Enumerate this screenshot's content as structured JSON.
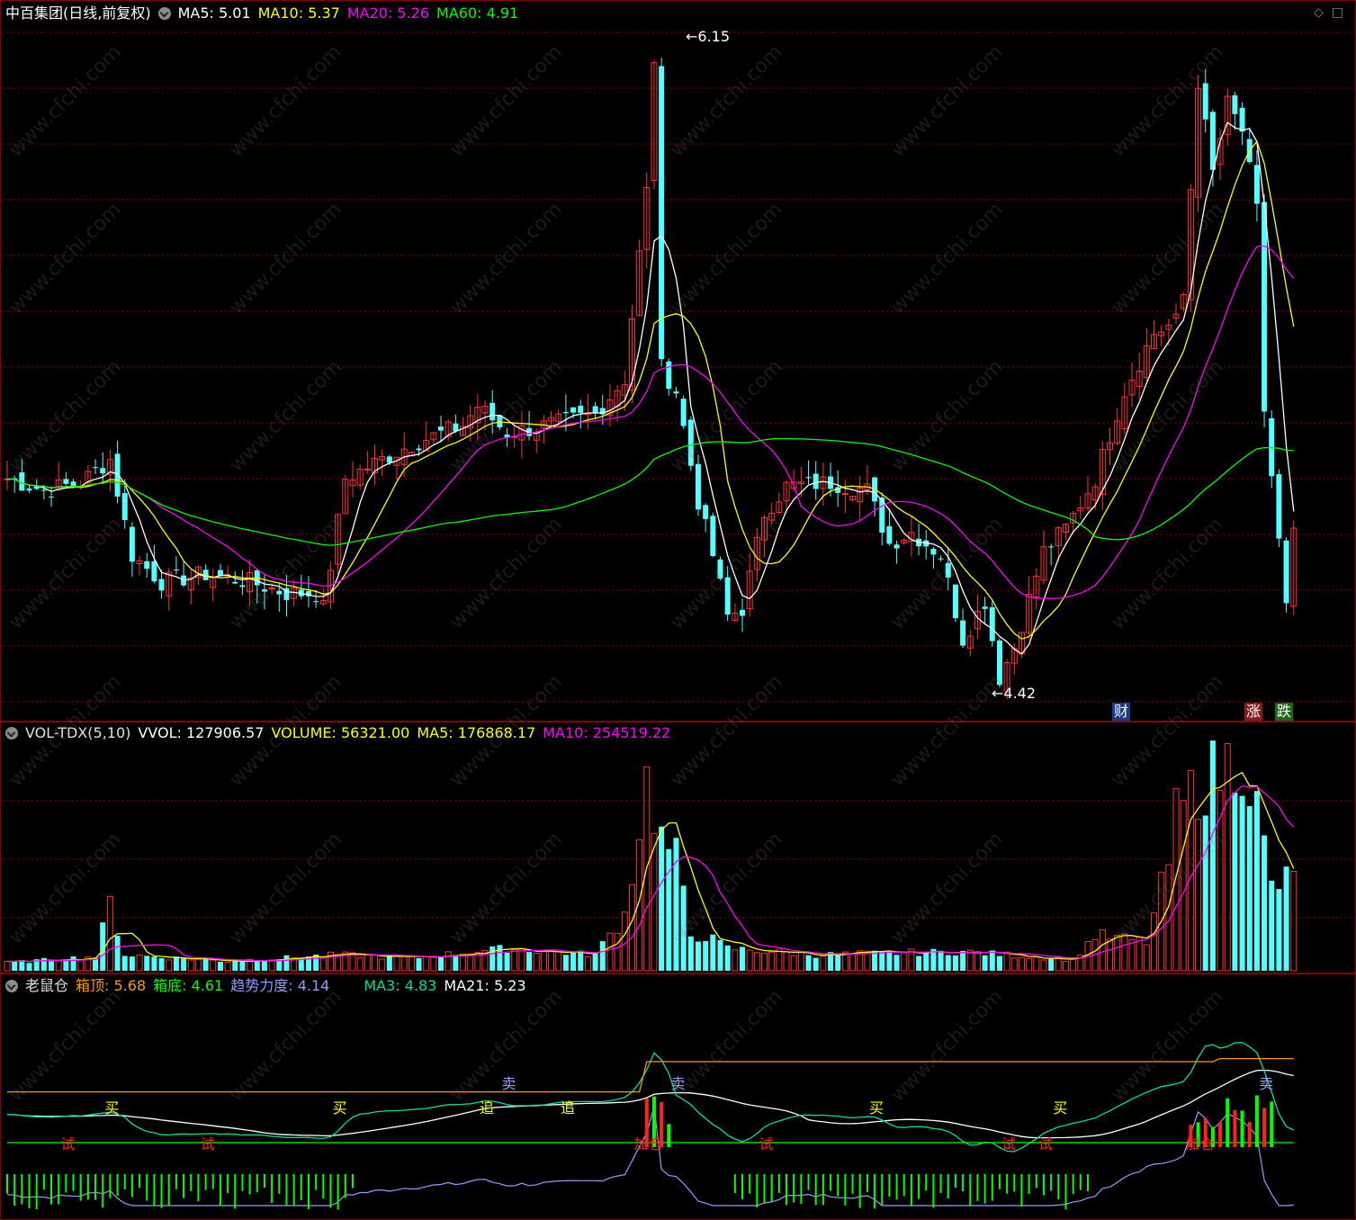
{
  "header_main": {
    "title": "中百集团(日线,前复权)",
    "items": [
      {
        "label": "MA5: 5.01",
        "color": "#ffffff"
      },
      {
        "label": "MA10: 5.37",
        "color": "#ffff00"
      },
      {
        "label": "MA20: 5.26",
        "color": "#ff00ff"
      },
      {
        "label": "MA60: 4.91",
        "color": "#00ff00"
      }
    ]
  },
  "header_vol": {
    "title": "VOL-TDX(5,10)",
    "items": [
      {
        "label": "VVOL: 127906.57",
        "color": "#ffffff"
      },
      {
        "label": "VOLUME: 56321.00",
        "color": "#ffff00"
      },
      {
        "label": "MA5: 176868.17",
        "color": "#ffff00"
      },
      {
        "label": "MA10: 254519.22",
        "color": "#ff00ff"
      }
    ]
  },
  "header_ind": {
    "title": "老鼠仓",
    "items": [
      {
        "label": "箱顶: 5.68",
        "color": "#ff9900"
      },
      {
        "label": "箱底: 4.61",
        "color": "#00ff00"
      },
      {
        "label": "趋势力度: 4.14",
        "color": "#9999ff"
      },
      {
        "label": "MA3: 4.83",
        "color": "#00e0a0"
      },
      {
        "label": "MA21: 5.23",
        "color": "#ffffff"
      }
    ]
  },
  "annotations": {
    "high_label": "6.15",
    "low_label": "4.42",
    "badges": [
      {
        "text": "财",
        "bg": "#1a3a8a",
        "color": "#ffffff"
      },
      {
        "text": "涨",
        "bg": "#8a1a1a",
        "color": "#ffffff"
      },
      {
        "text": "跌",
        "bg": "#1a6a1a",
        "color": "#ffffff"
      }
    ]
  },
  "signals": [
    {
      "text": "试",
      "color": "#ff2020",
      "day": 8
    },
    {
      "text": "买",
      "color": "#ffff00",
      "day": 14
    },
    {
      "text": "试",
      "color": "#ff2020",
      "day": 27
    },
    {
      "text": "买",
      "color": "#ffff00",
      "day": 45
    },
    {
      "text": "追",
      "color": "#ffff00",
      "day": 65
    },
    {
      "text": "卖",
      "color": "#9999ff",
      "day": 68
    },
    {
      "text": "追",
      "color": "#ffff00",
      "day": 76
    },
    {
      "text": "加仓",
      "color": "#ff2020",
      "day": 86
    },
    {
      "text": "卖",
      "color": "#9999ff",
      "day": 91
    },
    {
      "text": "试",
      "color": "#ff2020",
      "day": 103
    },
    {
      "text": "买",
      "color": "#ffff00",
      "day": 118
    },
    {
      "text": "试",
      "color": "#ff2020",
      "day": 136
    },
    {
      "text": "试",
      "color": "#ff2020",
      "day": 141
    },
    {
      "text": "买",
      "color": "#ffff00",
      "day": 143
    },
    {
      "text": "加仓",
      "color": "#ff2020",
      "day": 161
    },
    {
      "text": "卖",
      "color": "#9999ff",
      "day": 171
    }
  ],
  "watermark": "www.cfchi.com",
  "colors": {
    "up": "#ff3232",
    "down": "#54ffff",
    "grid": "#8b0000",
    "ma5": "#ffffff",
    "ma10": "#ffff00",
    "ma20": "#ff00ff",
    "ma60": "#00ff00"
  },
  "chart_data": {
    "type": "candlestick",
    "price_range": [
      4.42,
      6.15
    ],
    "close_keypoints": [
      [
        0,
        4.98
      ],
      [
        5,
        4.95
      ],
      [
        10,
        4.97
      ],
      [
        14,
        5.03
      ],
      [
        17,
        4.78
      ],
      [
        21,
        4.71
      ],
      [
        27,
        4.73
      ],
      [
        33,
        4.71
      ],
      [
        38,
        4.68
      ],
      [
        42,
        4.68
      ],
      [
        43,
        4.64
      ],
      [
        46,
        4.98
      ],
      [
        55,
        5.07
      ],
      [
        62,
        5.12
      ],
      [
        64,
        5.17
      ],
      [
        68,
        5.1
      ],
      [
        71,
        5.11
      ],
      [
        76,
        5.13
      ],
      [
        80,
        5.15
      ],
      [
        84,
        5.24
      ],
      [
        87,
        5.73
      ],
      [
        88,
        6.08
      ],
      [
        89,
        5.27
      ],
      [
        91,
        5.21
      ],
      [
        94,
        4.92
      ],
      [
        96,
        4.78
      ],
      [
        98,
        4.62
      ],
      [
        100,
        4.64
      ],
      [
        103,
        4.89
      ],
      [
        106,
        4.96
      ],
      [
        112,
        4.97
      ],
      [
        117,
        4.95
      ],
      [
        120,
        4.81
      ],
      [
        123,
        4.84
      ],
      [
        127,
        4.78
      ],
      [
        130,
        4.56
      ],
      [
        133,
        4.66
      ],
      [
        135,
        4.46
      ],
      [
        137,
        4.54
      ],
      [
        141,
        4.79
      ],
      [
        144,
        4.85
      ],
      [
        148,
        4.98
      ],
      [
        152,
        5.21
      ],
      [
        156,
        5.36
      ],
      [
        159,
        5.39
      ],
      [
        160,
        5.46
      ],
      [
        162,
        6.02
      ],
      [
        164,
        5.78
      ],
      [
        166,
        5.96
      ],
      [
        168,
        5.89
      ],
      [
        170,
        5.68
      ],
      [
        171,
        5.16
      ],
      [
        174,
        4.64
      ],
      [
        175,
        4.83
      ]
    ],
    "volume_keypoints": [
      [
        0,
        5000
      ],
      [
        12,
        9000
      ],
      [
        14,
        42000
      ],
      [
        16,
        10000
      ],
      [
        30,
        6000
      ],
      [
        45,
        10000
      ],
      [
        55,
        8000
      ],
      [
        68,
        14000
      ],
      [
        80,
        10000
      ],
      [
        84,
        35000
      ],
      [
        87,
        118000
      ],
      [
        88,
        101000
      ],
      [
        89,
        82000
      ],
      [
        91,
        70000
      ],
      [
        93,
        22000
      ],
      [
        95,
        22000
      ],
      [
        98,
        14000
      ],
      [
        110,
        10000
      ],
      [
        130,
        12000
      ],
      [
        145,
        7000
      ],
      [
        148,
        22000
      ],
      [
        155,
        18000
      ],
      [
        158,
        68000
      ],
      [
        159,
        96000
      ],
      [
        162,
        116000
      ],
      [
        165,
        125000
      ],
      [
        168,
        135000
      ],
      [
        170,
        101000
      ],
      [
        172,
        52000
      ],
      [
        174,
        56321
      ]
    ],
    "volume_range": [
      0,
      140000
    ],
    "ma_latest": {
      "MA5": 5.01,
      "MA10": 5.37,
      "MA20": 5.26,
      "MA60": 4.91
    },
    "indicator_latest": {
      "箱顶": 5.68,
      "箱底": 4.61,
      "趋势力度": 4.14,
      "MA3": 4.83,
      "MA21": 5.23
    }
  }
}
